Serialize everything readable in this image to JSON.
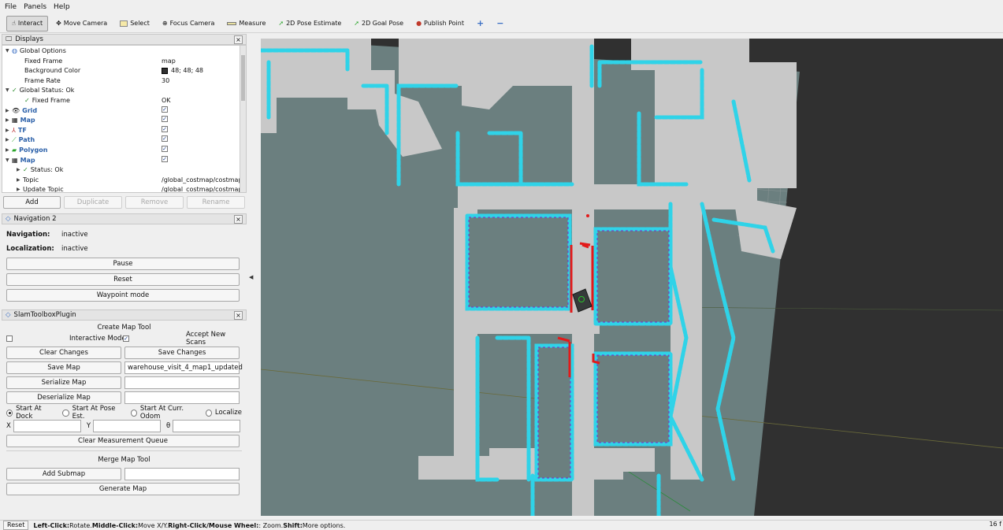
{
  "menu": {
    "file": "File",
    "panels": "Panels",
    "help": "Help"
  },
  "toolbar": {
    "interact": "Interact",
    "move_camera": "Move Camera",
    "select": "Select",
    "focus_camera": "Focus Camera",
    "measure": "Measure",
    "pose_estimate": "2D Pose Estimate",
    "goal_pose": "2D Goal Pose",
    "publish_point": "Publish Point"
  },
  "displays": {
    "title": "Displays",
    "rows": [
      {
        "label": "Global Options"
      },
      {
        "label": "Fixed Frame",
        "value": "map"
      },
      {
        "label": "Background Color",
        "value": "48; 48; 48"
      },
      {
        "label": "Frame Rate",
        "value": "30"
      },
      {
        "label": "Global Status: Ok"
      },
      {
        "label": "Fixed Frame",
        "value": "OK"
      },
      {
        "label": "Grid"
      },
      {
        "label": "Map"
      },
      {
        "label": "TF"
      },
      {
        "label": "Path"
      },
      {
        "label": "Polygon"
      },
      {
        "label": "Map"
      },
      {
        "label": "Status: Ok"
      },
      {
        "label": "Topic",
        "value": "/global_costmap/costmap"
      },
      {
        "label": "Update Topic",
        "value": "/global_costmap/costmap"
      }
    ],
    "add": "Add",
    "duplicate": "Duplicate",
    "remove": "Remove",
    "rename": "Rename"
  },
  "navigation": {
    "title": "Navigation 2",
    "nav_label": "Navigation:",
    "nav_value": "inactive",
    "loc_label": "Localization:",
    "loc_value": "inactive",
    "pause": "Pause",
    "reset": "Reset",
    "waypoint": "Waypoint mode"
  },
  "slam": {
    "title": "SlamToolboxPlugin",
    "create_map_tool": "Create Map Tool",
    "interactive_mode": "Interactive Mode",
    "accept_new_scans": "Accept New Scans",
    "clear_changes": "Clear Changes",
    "save_changes": "Save Changes",
    "save_map": "Save Map",
    "save_map_value": "warehouse_visit_4_map1_updated",
    "serialize_map": "Serialize Map",
    "deserialize_map": "Deserialize Map",
    "start_at_dock": "Start At Dock",
    "start_at_pose": "Start At Pose Est.",
    "start_at_odom": "Start At Curr. Odom",
    "localize": "Localize",
    "x_label": "X",
    "y_label": "Y",
    "theta_label": "θ",
    "clear_measurement": "Clear Measurement Queue",
    "merge_map_tool": "Merge Map Tool",
    "add_submap": "Add Submap",
    "generate_map": "Generate Map"
  },
  "status": {
    "reset": "Reset",
    "left_click": "Left-Click:",
    "left_click_text": " Rotate. ",
    "middle_click": "Middle-Click:",
    "middle_click_text": " Move X/Y. ",
    "right_click": "Right-Click/Mouse Wheel:",
    "right_click_text": ": Zoom. ",
    "shift": "Shift:",
    "shift_text": " More options.",
    "fps": "16 f"
  },
  "colors": {
    "background": "#303030",
    "map_free": "#c8c8c8",
    "map_unknown": "#6b7f7f",
    "inflation": "#2fd3e8",
    "lethal": "#7a2fd0",
    "path": "#e21a1a"
  }
}
